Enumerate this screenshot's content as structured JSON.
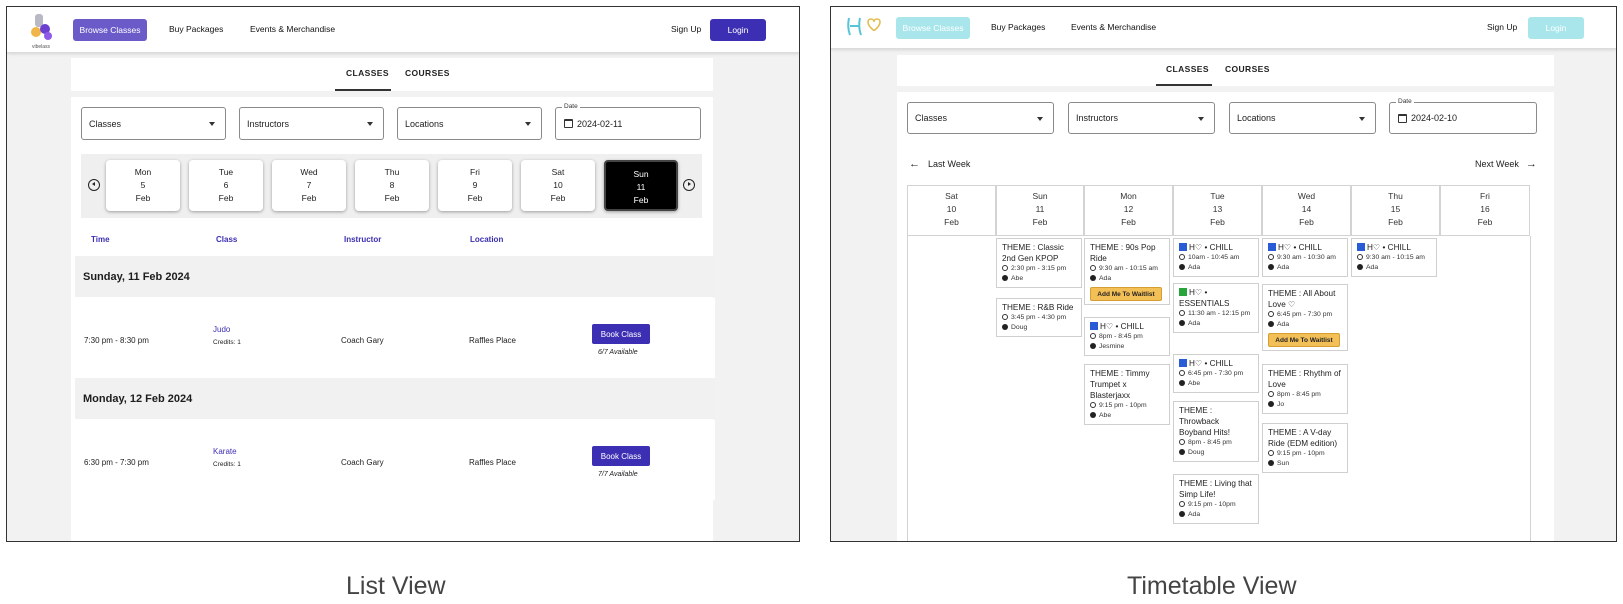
{
  "list_view": {
    "logo_text": "vibelass",
    "nav": {
      "browse_classes": "Browse Classes",
      "buy_packages": "Buy Packages",
      "events": "Events & Merchandise",
      "sign_up": "Sign Up",
      "login": "Login"
    },
    "tabs": [
      "CLASSES",
      "COURSES"
    ],
    "filters": {
      "classes": "Classes",
      "instructors": "Instructors",
      "locations": "Locations",
      "date_label": "Date",
      "date_value": "2024-02-11"
    },
    "days": [
      {
        "dow": "Mon",
        "day": "5",
        "mon": "Feb"
      },
      {
        "dow": "Tue",
        "day": "6",
        "mon": "Feb"
      },
      {
        "dow": "Wed",
        "day": "7",
        "mon": "Feb"
      },
      {
        "dow": "Thu",
        "day": "8",
        "mon": "Feb"
      },
      {
        "dow": "Fri",
        "day": "9",
        "mon": "Feb"
      },
      {
        "dow": "Sat",
        "day": "10",
        "mon": "Feb"
      },
      {
        "dow": "Sun",
        "day": "11",
        "mon": "Feb"
      }
    ],
    "columns": [
      "Time",
      "Class",
      "Instructor",
      "Location"
    ],
    "groups": [
      {
        "heading": "Sunday, 11 Feb 2024",
        "time": "7:30 pm - 8:30 pm",
        "class": "Judo",
        "credits": "Credits: 1",
        "instructor": "Coach Gary",
        "location": "Raffles Place",
        "button": "Book Class",
        "available": "6/7 Available"
      },
      {
        "heading": "Monday, 12 Feb 2024",
        "time": "6:30 pm - 7:30 pm",
        "class": "Karate",
        "credits": "Credits: 1",
        "instructor": "Coach Gary",
        "location": "Raffles Place",
        "button": "Book Class",
        "available": "7/7 Available"
      }
    ],
    "accent": "#3d2fb3"
  },
  "timetable_view": {
    "nav": {
      "browse_classes": "Browse Classes",
      "buy_packages": "Buy Packages",
      "events": "Events & Merchandise",
      "sign_up": "Sign Up",
      "login": "Login"
    },
    "tabs": [
      "CLASSES",
      "COURSES"
    ],
    "filters": {
      "classes": "Classes",
      "instructors": "Instructors",
      "locations": "Locations",
      "date_label": "Date",
      "date_value": "2024-02-10"
    },
    "last_week": "Last Week",
    "next_week": "Next Week",
    "days": [
      {
        "dow": "Sat",
        "day": "10",
        "mon": "Feb"
      },
      {
        "dow": "Sun",
        "day": "11",
        "mon": "Feb"
      },
      {
        "dow": "Mon",
        "day": "12",
        "mon": "Feb"
      },
      {
        "dow": "Tue",
        "day": "13",
        "mon": "Feb"
      },
      {
        "dow": "Wed",
        "day": "14",
        "mon": "Feb"
      },
      {
        "dow": "Thu",
        "day": "15",
        "mon": "Feb"
      },
      {
        "dow": "Fri",
        "day": "16",
        "mon": "Feb"
      }
    ],
    "sun": [
      {
        "title": "THEME : Classic 2nd Gen KPOP",
        "time": "2:30 pm - 3:15 pm",
        "who": "Abe"
      },
      {
        "title": "THEME : R&B Ride",
        "time": "3:45 pm - 4:30 pm",
        "who": "Doug"
      }
    ],
    "mon": [
      {
        "title": "THEME : 90s Pop Ride",
        "time": "9:30 am - 10:15 am",
        "who": "Ada",
        "waitlist": "Add Me To Waitlist"
      },
      {
        "title": "H♡ • CHILL",
        "time": "8pm - 8:45 pm",
        "who": "Jesmine"
      },
      {
        "title": "THEME : Timmy Trumpet x Blasterjaxx",
        "time": "9:15 pm - 10pm",
        "who": "Abe"
      }
    ],
    "tue": [
      {
        "title": "H♡ • CHILL",
        "time": "10am - 10:45 am",
        "who": "Ada"
      },
      {
        "title": "H♡ • ESSENTIALS",
        "time": "11:30 am - 12:15 pm",
        "who": "Ada"
      },
      {
        "title": "H♡ • CHILL",
        "time": "6:45 pm - 7:30 pm",
        "who": "Abe"
      },
      {
        "title": "THEME : Throwback Boyband Hits!",
        "time": "8pm - 8:45 pm",
        "who": "Doug"
      },
      {
        "title": "THEME : Living that Simp Life!",
        "time": "9:15 pm - 10pm",
        "who": "Ada"
      }
    ],
    "wed": [
      {
        "title": "H♡ • CHILL",
        "time": "9:30 am - 10:30 am",
        "who": "Ada"
      },
      {
        "title": "THEME : All About Love ♡",
        "time": "6:45 pm - 7:30 pm",
        "who": "Ada",
        "waitlist": "Add Me To Waitlist"
      },
      {
        "title": "THEME : Rhythm of Love",
        "time": "8pm - 8:45 pm",
        "who": "Jo"
      },
      {
        "title": "THEME : A V-day Ride (EDM edition)",
        "time": "9:15 pm - 10pm",
        "who": "Sun"
      }
    ],
    "thu": [
      {
        "title": "H♡ • CHILL",
        "time": "9:30 am - 10:15 am",
        "who": "Ada"
      }
    ],
    "accent": "#a8e6ec"
  },
  "captions": {
    "left": "List View",
    "right": "Timetable View"
  }
}
